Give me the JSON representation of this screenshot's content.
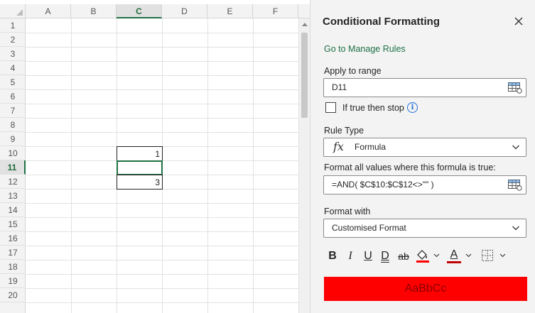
{
  "sheet": {
    "columns": [
      "A",
      "B",
      "C",
      "D",
      "E",
      "F"
    ],
    "selected_column": "C",
    "rows": [
      "1",
      "2",
      "3",
      "4",
      "5",
      "6",
      "7",
      "8",
      "9",
      "10",
      "11",
      "12",
      "13",
      "14",
      "15",
      "16",
      "17",
      "18",
      "19",
      "20"
    ],
    "selected_row": "11",
    "cells": [
      {
        "ref": "C10",
        "value": "1"
      },
      {
        "ref": "C11",
        "value": ""
      },
      {
        "ref": "C12",
        "value": "3"
      }
    ]
  },
  "pane": {
    "title": "Conditional Formatting",
    "manage_rules_link": "Go to Manage Rules",
    "apply_to_range_label": "Apply to range",
    "apply_to_range_value": "D11",
    "if_true_stop_label": "If true then stop",
    "if_true_stop_checked": false,
    "info_glyph": "i",
    "rule_type_label": "Rule Type",
    "rule_type_icon_text": "fx",
    "rule_type_value": "Formula",
    "formula_label": "Format all values where this formula is true:",
    "formula_value": "=AND( $C$10:$C$12<>\"\" )",
    "format_with_label": "Format with",
    "format_with_value": "Customised Format",
    "toolbar": {
      "bold": "B",
      "italic": "I",
      "underline": "U",
      "double_underline": "D",
      "strikethrough": "ab",
      "font_color_glyph": "A"
    },
    "fill_color": "#ff0000",
    "font_color": "#c00000",
    "preview_text": "AaBbCc",
    "preview_fill": "#ff0000",
    "preview_text_color": "#8b0000",
    "accent_color": "#1e7145"
  }
}
